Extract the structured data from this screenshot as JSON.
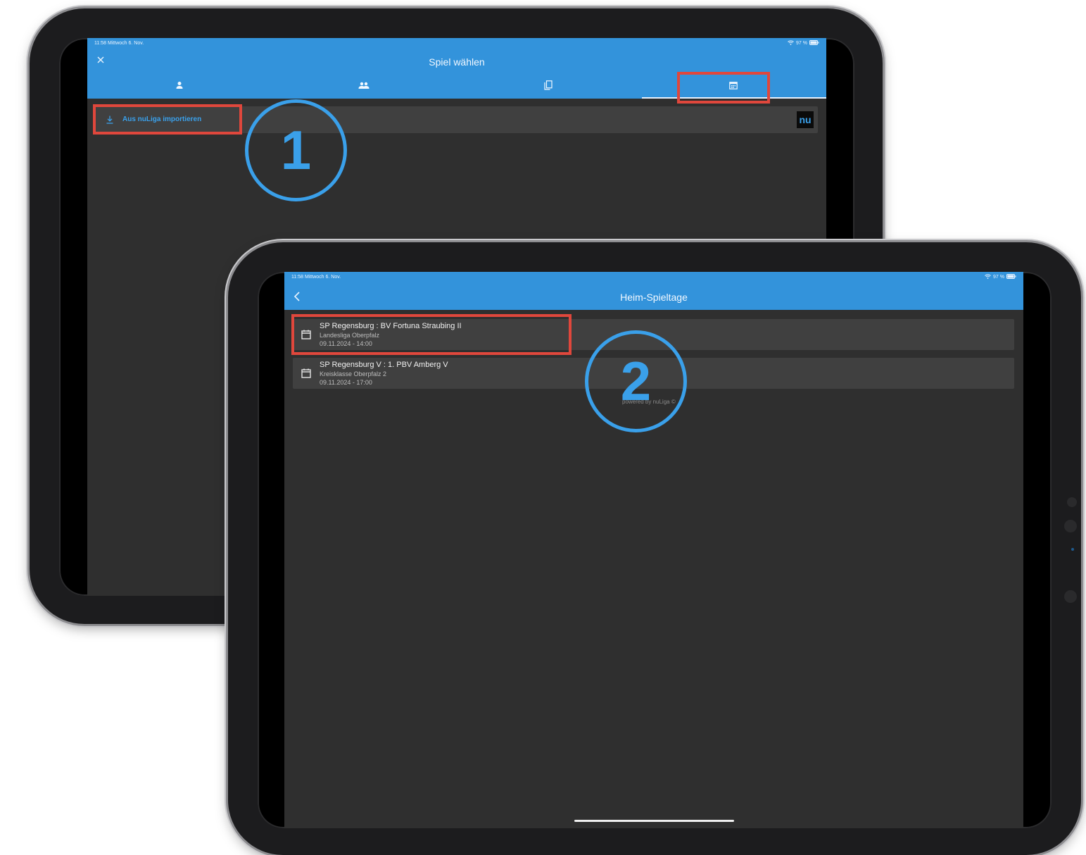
{
  "step1": {
    "status_time": "11:58  Mittwoch 6. Nov.",
    "status_battery": "97 %",
    "title": "Spiel wählen",
    "close_glyph": "×",
    "tabs": [
      {
        "icon": "person-icon"
      },
      {
        "icon": "group-icon"
      },
      {
        "icon": "copy-icon"
      },
      {
        "icon": "calendar-icon",
        "selected": true
      }
    ],
    "import_label": "Aus nuLiga importieren",
    "nu_logo": "nu",
    "step_number": "1"
  },
  "step2": {
    "status_time": "11:58  Mittwoch 6. Nov.",
    "status_battery": "97 %",
    "title": "Heim-Spieltage",
    "back_glyph": "‹",
    "matches": [
      {
        "title": "SP Regensburg : BV Fortuna Straubing II",
        "league": "Landesliga Oberpfalz",
        "datetime": "09.11.2024 - 14:00"
      },
      {
        "title": "SP Regensburg V : 1. PBV Amberg V",
        "league": "Kreisklasse Oberpfalz 2",
        "datetime": "09.11.2024 - 17:00"
      }
    ],
    "powered_by": "powered by nuLiga ©",
    "step_number": "2"
  },
  "colors": {
    "appbar": "#3393db",
    "screen_bg": "#2f2f2f",
    "row_bg": "#404040",
    "highlight_red": "#e0473c",
    "step_blue": "#3aa0ea"
  }
}
